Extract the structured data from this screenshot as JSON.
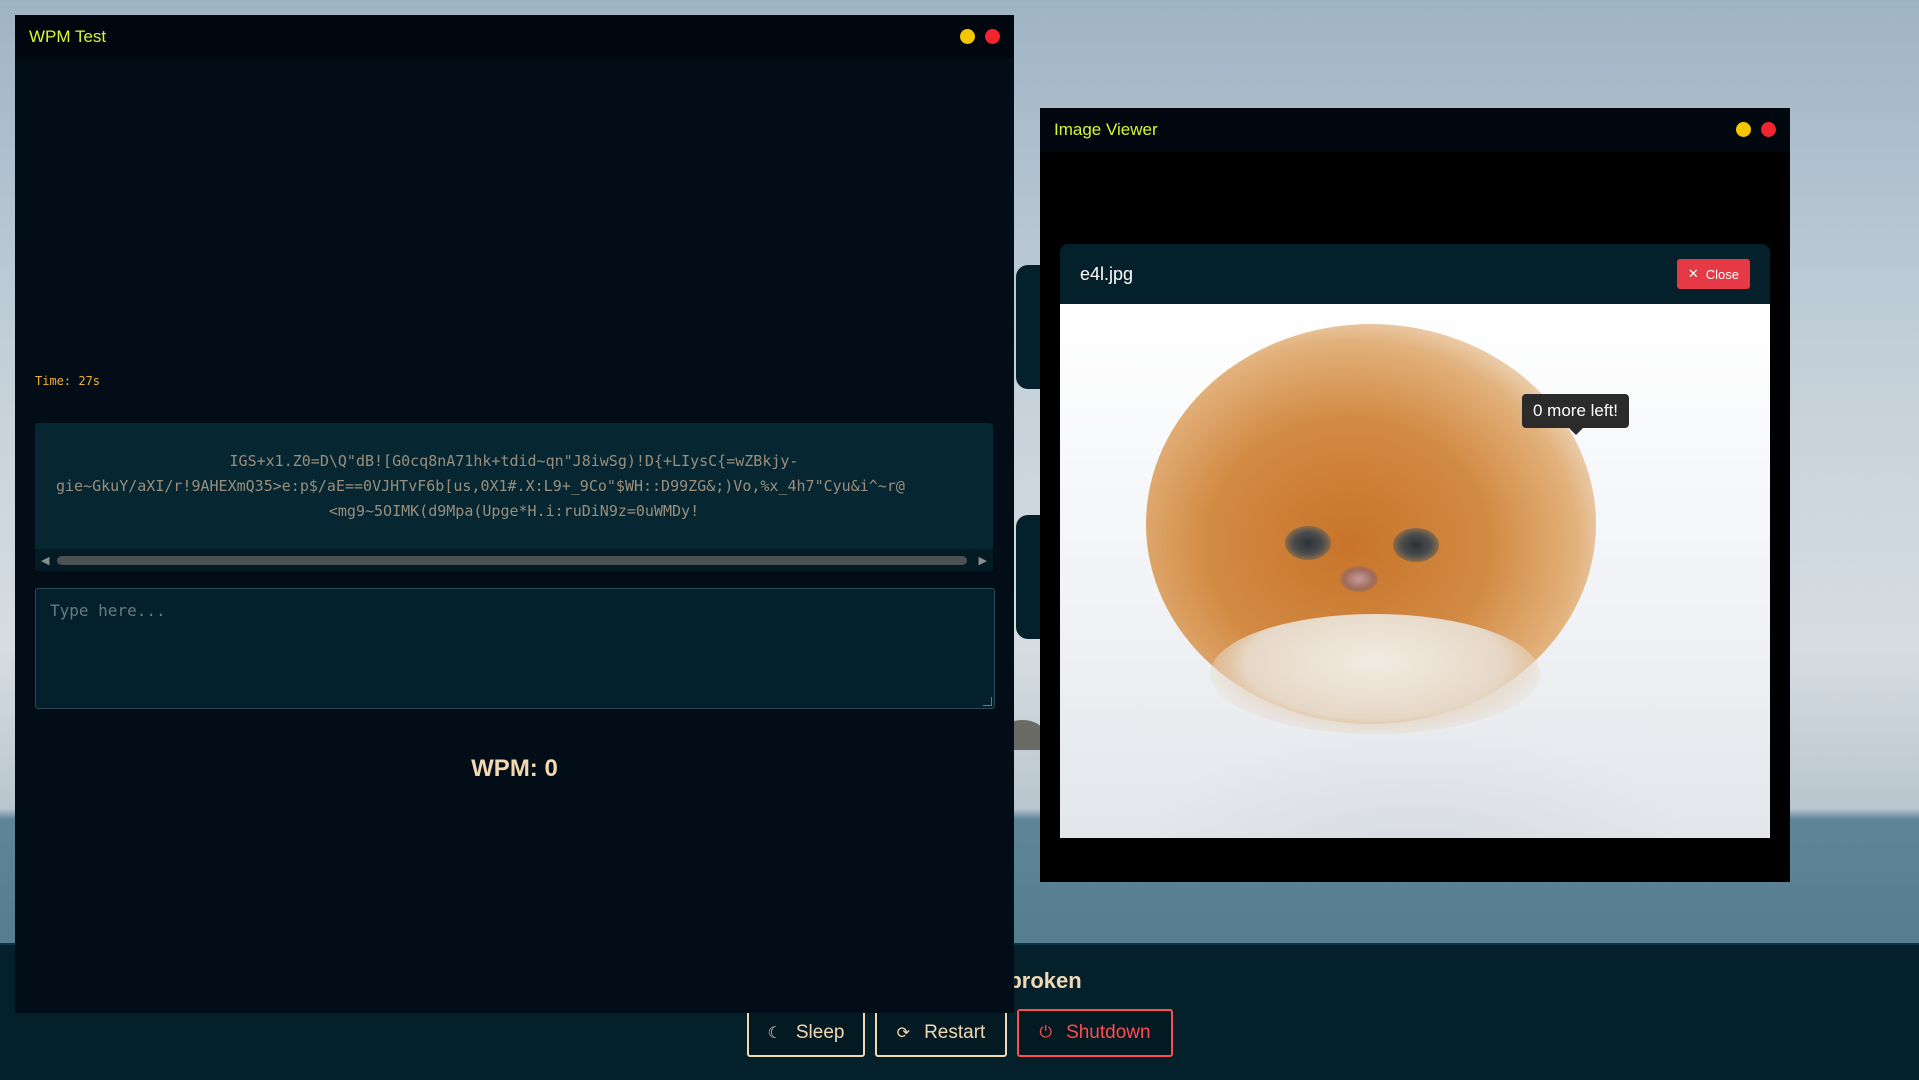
{
  "desktop": {
    "dock_title": "s broken",
    "buttons": [
      {
        "label": "Sleep",
        "icon": "moon-icon"
      },
      {
        "label": "Restart",
        "icon": "power-cycle-icon"
      },
      {
        "label": "Shutdown",
        "icon": "power-icon"
      }
    ]
  },
  "wpm_window": {
    "title": "WPM Test",
    "timer": "Time: 27s",
    "target_lines": [
      "IGS+x1.Z0=D\\Q\"dB![G0cq8nA71hk+tdid~qn\"J8iwSg)!D{+LIysC{=wZBkjy-",
      "gie~GkuY/aXI/r!9AHEXmQ35>e:p$/aE==0VJHTvF6b[us,0X1#.X:L9+_9Co\"$WH::D99ZG&;)Vo,%x_4h7\"Cyu&i^~r@",
      "<mg9~5OIMK(d9Mpa(Upge*H.i:ruDiN9z=0uWMDy!"
    ],
    "input_placeholder": "Type here...",
    "wpm_label": "WPM: 0"
  },
  "viewer_window": {
    "title": "Image Viewer",
    "file_name": "e4l.jpg",
    "close_label": "Close",
    "tooltip": "0 more left!"
  },
  "colors": {
    "accent_title": "#d8f52e",
    "warm_text": "#f3d9b3",
    "danger": "#ff4d4d",
    "minimize": "#f6c600",
    "close": "#f0252f"
  }
}
